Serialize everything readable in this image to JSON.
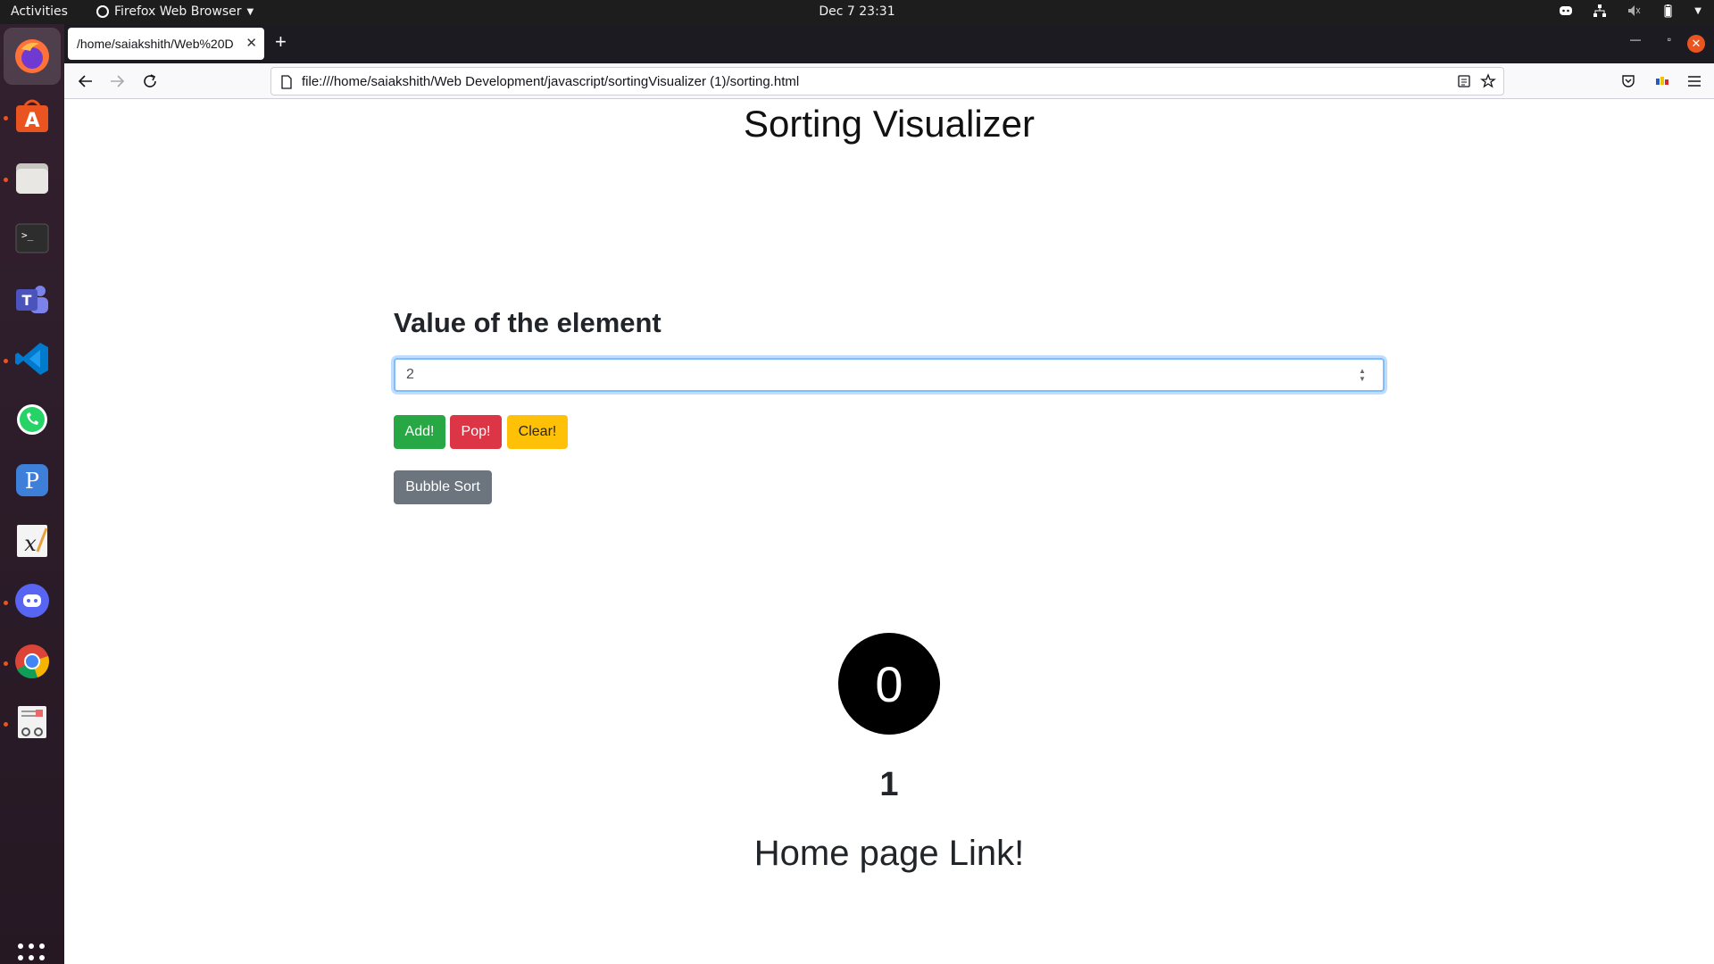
{
  "topbar": {
    "activities": "Activities",
    "app_name": "Firefox Web Browser",
    "clock": "Dec 7  23:31",
    "tray_icons": [
      "discord-tray-icon",
      "network-icon",
      "volume-muted-icon",
      "battery-icon",
      "system-menu-chevron-icon"
    ]
  },
  "dock": {
    "apps": [
      "firefox",
      "ubuntu-software",
      "files",
      "terminal",
      "teams",
      "vscode",
      "whatsapp",
      "pdf-editor",
      "xournal",
      "discord",
      "chrome",
      "document-viewer"
    ],
    "running": [
      "firefox",
      "ubuntu-software",
      "files",
      "vscode",
      "discord",
      "chrome",
      "document-viewer"
    ]
  },
  "browser": {
    "tab_title": "/home/saiakshith/Web%20D",
    "url": "file:///home/saiakshith/Web Development/javascript/sortingVisualizer (1)/sorting.html"
  },
  "page": {
    "title": "Sorting Visualizer",
    "input_label": "Value of the element",
    "input_value": "2",
    "buttons": {
      "add": "Add!",
      "pop": "Pop!",
      "clear": "Clear!",
      "bubble_sort": "Bubble Sort"
    },
    "array_elements": [
      "0"
    ],
    "count": "1",
    "home_link": "Home page Link!"
  },
  "colors": {
    "add": "#28a745",
    "pop": "#dc3545",
    "clear": "#ffc107",
    "sort": "#6c757d",
    "accent": "#e95420"
  }
}
